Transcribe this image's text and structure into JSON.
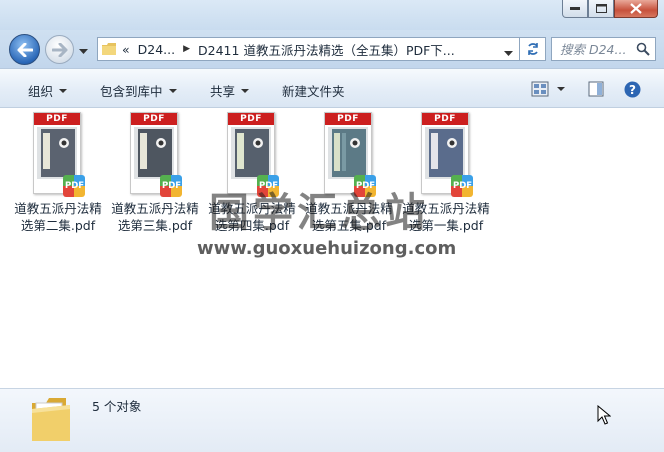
{
  "window": {
    "caption_buttons": [
      "minimize",
      "maximize",
      "close"
    ]
  },
  "nav": {
    "breadcrumb": [
      "D24...",
      "D2411 道教五派丹法精选（全五集）PDF下..."
    ],
    "breadcrumb_overflow": "«",
    "search_placeholder": "搜索 D24..."
  },
  "toolbar": {
    "organize": "组织",
    "include_in_library": "包含到库中",
    "share": "共享",
    "new_folder": "新建文件夹"
  },
  "files": [
    {
      "name": "道教五派丹法精选第二集.pdf",
      "cover": "#5b6370"
    },
    {
      "name": "道教五派丹法精选第三集.pdf",
      "cover": "#4e5660"
    },
    {
      "name": "道教五派丹法精选第四集.pdf",
      "cover": "#56606d"
    },
    {
      "name": "道教五派丹法精选第五集.pdf",
      "cover": "#5c7a86"
    },
    {
      "name": "道教五派丹法精选第一集.pdf",
      "cover": "#5a6c8c"
    }
  ],
  "pdf_label": "PDF",
  "watermark": {
    "main": "国学汇总站",
    "url": "www.guoxuehuizong.com"
  },
  "details": {
    "count": "5 个对象"
  }
}
